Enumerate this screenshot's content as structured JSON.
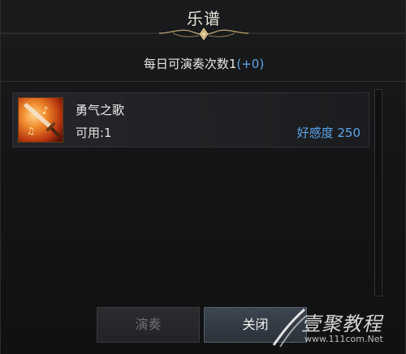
{
  "dialog": {
    "title": "乐谱",
    "subtitle_prefix": "每日可演奏次数1",
    "subtitle_bonus": "(+0)"
  },
  "songs": [
    {
      "name": "勇气之歌",
      "available": "可用:1",
      "affinity": "好感度 250",
      "icon": "music-sword-icon"
    }
  ],
  "buttons": {
    "play_label": "演奏",
    "close_label": "关闭"
  },
  "watermark": {
    "text": "壹聚教程",
    "url": "www.111com.Net",
    "logo": "swoosh-logo"
  },
  "colors": {
    "accent_blue": "#5ca5ea",
    "gold_ornament": "#b39a6a",
    "icon_orange": "#d2561c"
  }
}
